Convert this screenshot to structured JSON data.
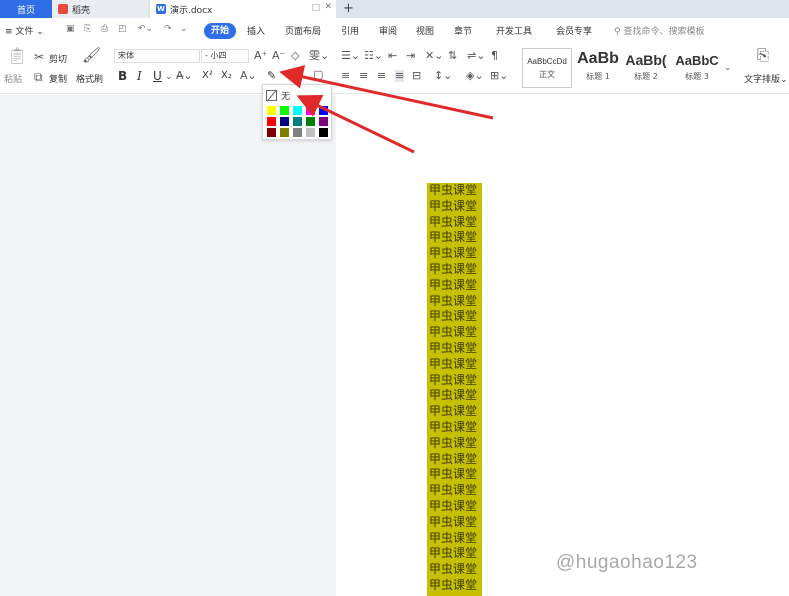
{
  "tabs": {
    "home": "首页",
    "daoke": "稻壳",
    "doc": "演示.docx"
  },
  "menu": {
    "file": "文件",
    "items": [
      "开始",
      "插入",
      "页面布局",
      "引用",
      "审阅",
      "视图",
      "章节",
      "开发工具",
      "会员专享"
    ],
    "search": "查找命令、搜索模板"
  },
  "ribbon": {
    "paste": "粘贴",
    "cut": "剪切",
    "copy": "复制",
    "format_painter": "格式刷",
    "font_name": "宋体",
    "font_size": "小四",
    "bold": "B",
    "italic": "I",
    "underline": "U",
    "superscript": "X²",
    "subscript": "X₂",
    "text_layout": "文字排版",
    "styles": [
      {
        "preview": "AaBbCcDd",
        "name": "正文"
      },
      {
        "preview": "AaBb",
        "name": "标题 1"
      },
      {
        "preview": "AaBb(",
        "name": "标题 2"
      },
      {
        "preview": "AaBbC",
        "name": "标题 3"
      }
    ]
  },
  "highlight_dropdown": {
    "none_label": "无",
    "swatches": [
      "#ffff00",
      "#00ff00",
      "#00ffff",
      "#ff00ff",
      "#0000ff",
      "#ff0000",
      "#000080",
      "#008080",
      "#008000",
      "#800080",
      "#800000",
      "#808000",
      "#808080",
      "#c0c0c0",
      "#000000"
    ]
  },
  "document": {
    "lines": [
      "甲虫课堂",
      "甲虫课堂",
      "甲虫课堂",
      "甲虫课堂",
      "甲虫课堂",
      "甲虫课堂",
      "甲虫课堂",
      "甲虫课堂",
      "甲虫课堂",
      "甲虫课堂",
      "甲虫课堂",
      "甲虫课堂",
      "甲虫课堂",
      "甲虫课堂",
      "甲虫课堂",
      "甲虫课堂",
      "甲虫课堂",
      "甲虫课堂",
      "甲虫课堂",
      "甲虫课堂",
      "甲虫课堂",
      "甲虫课堂",
      "甲虫课堂",
      "甲虫课堂",
      "甲虫课堂",
      "甲虫课堂"
    ],
    "highlight_color": "#c7c000"
  },
  "watermark": "@hugaohao123",
  "colors": {
    "accent": "#2f6ee6",
    "arrow": "#e02a2a"
  }
}
